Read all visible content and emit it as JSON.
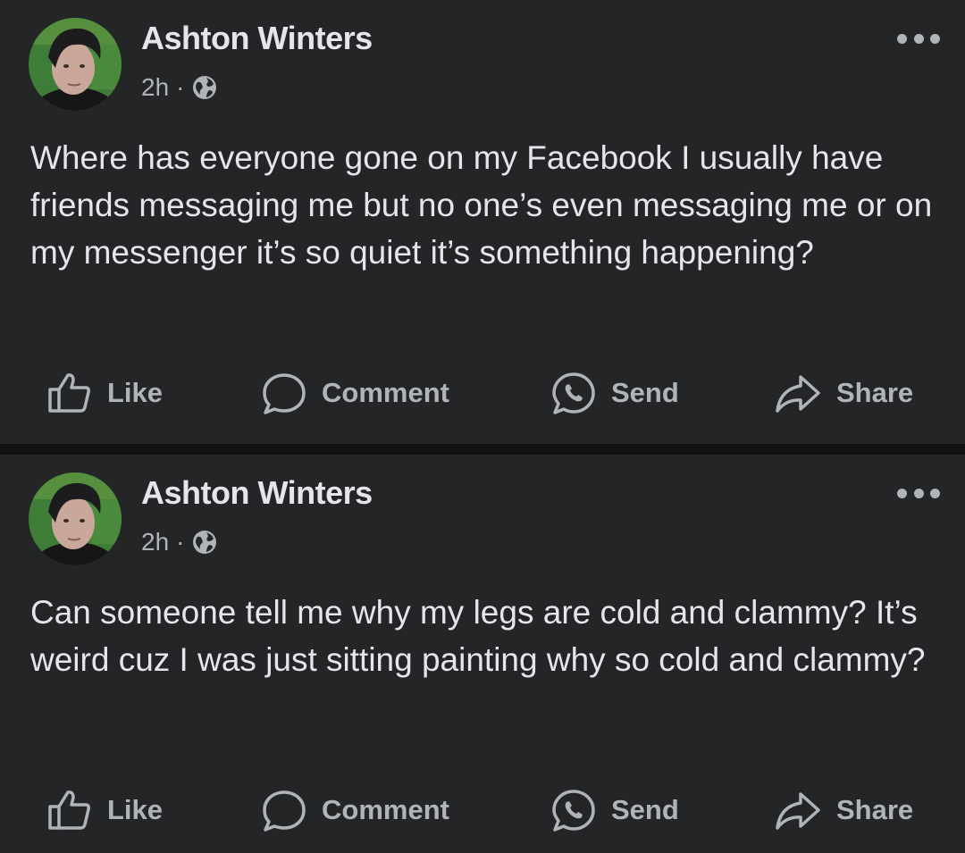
{
  "posts": [
    {
      "author": "Ashton Winters",
      "time": "2h",
      "separator": "·",
      "privacy_icon": "globe-icon",
      "text": "Where has everyone gone on my Facebook I usually have friends messaging me but no one’s even messaging me or on my messenger it’s so quiet it’s something happening?",
      "actions": {
        "like": "Like",
        "comment": "Comment",
        "send": "Send",
        "share": "Share"
      }
    },
    {
      "author": "Ashton Winters",
      "time": "2h",
      "separator": "·",
      "privacy_icon": "globe-icon",
      "text": "Can someone tell me why my legs are cold and clammy? It’s weird cuz I was just sitting painting why so cold and clammy?",
      "actions": {
        "like": "Like",
        "comment": "Comment",
        "send": "Send",
        "share": "Share"
      }
    }
  ],
  "colors": {
    "background": "#111111",
    "card": "#242526",
    "primary_text": "#e4e6eb",
    "secondary_text": "#b0b3b8"
  }
}
